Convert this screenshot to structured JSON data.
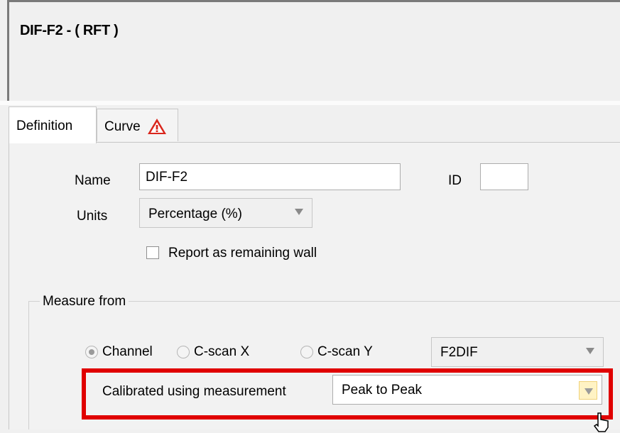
{
  "window": {
    "title": "DIF-F2 - ( RFT )"
  },
  "tabs": [
    {
      "label": "Definition",
      "active": true
    },
    {
      "label": "Curve",
      "icon": "warning-icon"
    }
  ],
  "form": {
    "name_label": "Name",
    "name_value": "DIF-F2",
    "id_label": "ID",
    "id_value": "",
    "units_label": "Units",
    "units_value": "Percentage (%)",
    "report_remaining_wall": {
      "label": "Report as remaining wall",
      "checked": false
    }
  },
  "measure_from": {
    "title": "Measure from",
    "radios": [
      {
        "label": "Channel",
        "selected": true
      },
      {
        "label": "C-scan X",
        "selected": false
      },
      {
        "label": "C-scan Y",
        "selected": false
      }
    ],
    "channel_value": "F2DIF",
    "calibrated_label": "Calibrated using measurement",
    "calibrated_value": "Peak to Peak"
  },
  "colors": {
    "highlight": "#e00000",
    "warning": "#d9261c",
    "dropdown_hover": "#fff3c4"
  }
}
